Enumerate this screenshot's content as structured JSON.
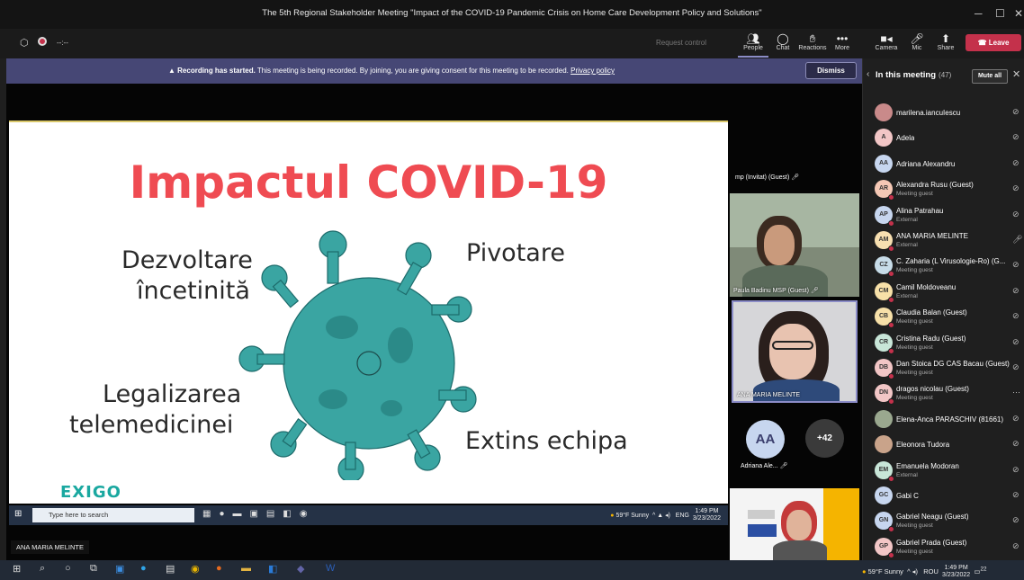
{
  "window": {
    "title": "The 5th Regional Stakeholder Meeting \"Impact of the COVID-19 Pandemic Crisis on Home Care Development Policy and Solutions\"",
    "timer": "--:--"
  },
  "toolbar": {
    "request_control": "Request control",
    "people": "People",
    "chat": "Chat",
    "reactions": "Reactions",
    "more": "More",
    "camera": "Camera",
    "mic": "Mic",
    "share": "Share",
    "leave": "Leave"
  },
  "banner": {
    "bold": "Recording has started.",
    "text": "This meeting is being recorded. By joining, you are giving consent for this meeting to be recorded.",
    "link": "Privacy policy",
    "dismiss": "Dismiss"
  },
  "slide": {
    "title": "Impactul COVID-19",
    "top_left_1": "Dezvoltare",
    "top_left_2": "încetinită",
    "top_right": "Pivotare",
    "bottom_left_1": "Legalizarea",
    "bottom_left_2": "telemedicinei",
    "bottom_right": "Extins echipa",
    "logo": "EXIGO"
  },
  "inner_taskbar": {
    "search": "Type here to search",
    "weather": "59°F Sunny",
    "lang": "ENG",
    "time": "1:49 PM",
    "date": "3/23/2022"
  },
  "presenter_tag": "ANA MARIA MELINTE",
  "tiles": {
    "guest1": "mp (Invitat) (Guest)",
    "paula": "Paula Badinu MSP (Guest)",
    "ana": "ANA MARIA MELINTE",
    "adriana_initials": "AA",
    "adriana_label": "Adriana Ale...",
    "overflow": "+42"
  },
  "panel": {
    "title": "In this meeting",
    "count": "(47)",
    "mute_all": "Mute all",
    "participants": [
      {
        "initials": "",
        "name": "marilena.iancuIescu",
        "sub": "",
        "color": "#c98a8a"
      },
      {
        "initials": "A",
        "name": "Adela",
        "sub": "",
        "color": "#f2c6c6"
      },
      {
        "initials": "AA",
        "name": "Adriana Alexandru",
        "sub": "",
        "color": "#c7d6ef"
      },
      {
        "initials": "AR",
        "name": "Alexandra Rusu (Guest)",
        "sub": "Meeting guest",
        "color": "#f5c8b5"
      },
      {
        "initials": "AP",
        "name": "Alina Patrahau",
        "sub": "External",
        "color": "#c7d6ef"
      },
      {
        "initials": "AM",
        "name": "ANA MARIA MELINTE",
        "sub": "External",
        "color": "#f7dfb0"
      },
      {
        "initials": "CZ",
        "name": "C. Zaharia (L Virusologie-Ro) (G...",
        "sub": "Meeting guest",
        "color": "#c7dce8"
      },
      {
        "initials": "CM",
        "name": "Camil Moldoveanu",
        "sub": "External",
        "color": "#f7e0a8"
      },
      {
        "initials": "CB",
        "name": "Claudia Balan (Guest)",
        "sub": "Meeting guest",
        "color": "#f7e0a8"
      },
      {
        "initials": "CR",
        "name": "Cristina Radu (Guest)",
        "sub": "Meeting guest",
        "color": "#c8e6d8"
      },
      {
        "initials": "DB",
        "name": "Dan Stoica DG CAS Bacau (Guest)",
        "sub": "Meeting guest",
        "color": "#f2c6c6"
      },
      {
        "initials": "DN",
        "name": "dragos nicolau (Guest)",
        "sub": "Meeting guest",
        "color": "#f2c6c6"
      },
      {
        "initials": "",
        "name": "Elena-Anca PARASCHIV (81661)",
        "sub": "",
        "color": "#9aa88f"
      },
      {
        "initials": "",
        "name": "Eleonora Tudora",
        "sub": "",
        "color": "#c9a38a"
      },
      {
        "initials": "EM",
        "name": "Emanuela Modoran",
        "sub": "External",
        "color": "#c8e6d8"
      },
      {
        "initials": "GC",
        "name": "Gabi C",
        "sub": "",
        "color": "#c7d6ef"
      },
      {
        "initials": "GN",
        "name": "Gabriel Neagu (Guest)",
        "sub": "Meeting guest",
        "color": "#c7d6ef"
      },
      {
        "initials": "GP",
        "name": "Gabriel Prada (Guest)",
        "sub": "Meeting guest",
        "color": "#f2c6c6"
      }
    ]
  },
  "taskbar": {
    "weather": "59°F Sunny",
    "lang": "ROU",
    "time": "1:49 PM",
    "date": "3/23/2022",
    "notif": "22"
  }
}
